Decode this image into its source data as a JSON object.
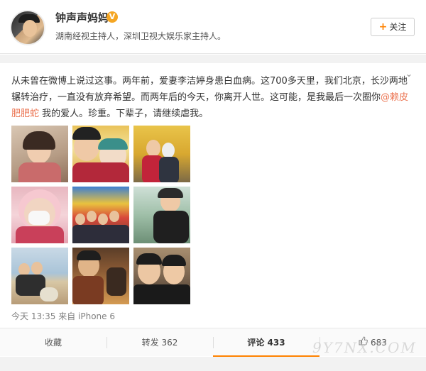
{
  "header": {
    "name": "钟声声妈妈",
    "verified_badge": "V",
    "description": "湖南经视主持人，深圳卫视大娱乐家主持人。",
    "follow_label": "关注",
    "follow_icon": "plus-icon"
  },
  "post": {
    "text_part1": "从未曾在微博上说过这事。两年前，爱妻李洁婷身患白血病。这700多天里，我们北京，长沙两地辗转治疗，一直没有放弃希望。而两年后的今天，你离开人世。这可能，是我最后一次圈你",
    "mention": "@赖皮肥肥蛇",
    "text_part2": " 我的爱人。珍重。下辈子，请继续虐我。",
    "menu_icon": "chevron-down-icon",
    "meta": "今天 13:35 来自 iPhone 6"
  },
  "actions": {
    "favorite": "收藏",
    "repost": "转发 362",
    "comment": "评论 433",
    "like": "683",
    "like_icon": "thumb-up-icon"
  },
  "watermark": "9Y7NX.COM",
  "colors": {
    "accent": "#ff8200",
    "mention": "#eb7350",
    "verified": "#f5a623"
  }
}
